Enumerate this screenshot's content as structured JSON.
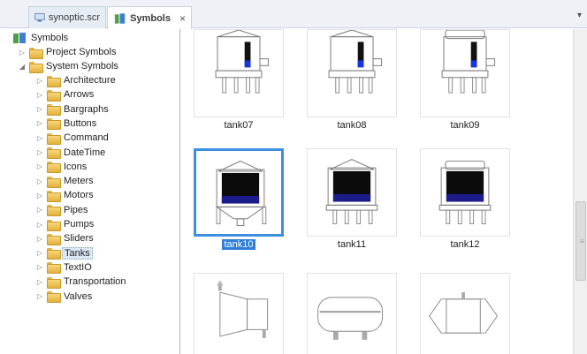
{
  "tabs": [
    {
      "label": "synoptic.scr",
      "active": false
    },
    {
      "label": "Symbols",
      "active": true
    }
  ],
  "tab_close_glyph": "×",
  "tab_dropdown_glyph": "▾",
  "tree": {
    "root": "Symbols",
    "project": "Project Symbols",
    "system": "System Symbols",
    "categories": [
      "Architecture",
      "Arrows",
      "Bargraphs",
      "Buttons",
      "Command",
      "DateTime",
      "Icons",
      "Meters",
      "Motors",
      "Pipes",
      "Pumps",
      "Sliders",
      "Tanks",
      "TextIO",
      "Transportation",
      "Valves"
    ],
    "selected": "Tanks"
  },
  "symbols": [
    {
      "label": "tank07",
      "style": "dome-valve"
    },
    {
      "label": "tank08",
      "style": "dome-valve"
    },
    {
      "label": "tank09",
      "style": "flat"
    },
    {
      "label": "tank10",
      "style": "dome-hopper",
      "selected": true
    },
    {
      "label": "tank11",
      "style": "dome-legs"
    },
    {
      "label": "tank12",
      "style": "flat-legs"
    },
    {
      "label": "",
      "style": "cone"
    },
    {
      "label": "",
      "style": "cylinder"
    },
    {
      "label": "",
      "style": "hex"
    }
  ],
  "colors": {
    "accent": "#3d8fe2",
    "liquid": "#1a32e6",
    "metal": "#b8bcc4"
  }
}
